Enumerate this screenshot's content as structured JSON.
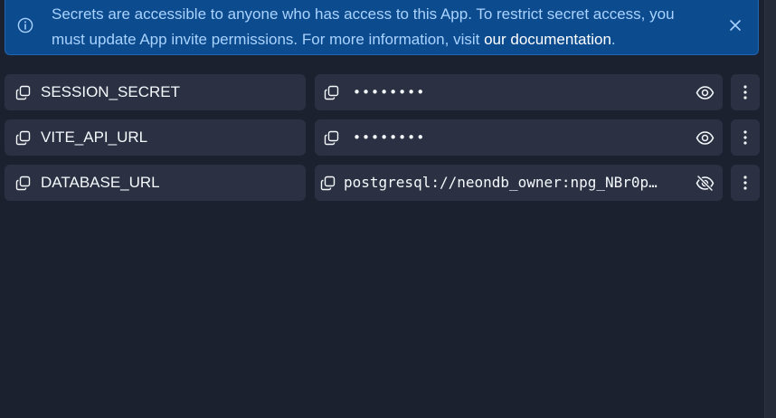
{
  "banner": {
    "message": "Secrets are accessible to anyone who has access to this App. To restrict secret access, you must update App invite permissions. For more information, visit ",
    "link_text": "our documentation",
    "trailing": "."
  },
  "secrets": [
    {
      "key": "SESSION_SECRET",
      "value": "••••••••",
      "revealed": false
    },
    {
      "key": "VITE_API_URL",
      "value": "••••••••",
      "revealed": false
    },
    {
      "key": "DATABASE_URL",
      "value": "postgresql://neondb_owner:npg_NBr0p…",
      "revealed": true
    }
  ],
  "colors": {
    "background": "#1c2130",
    "row_background": "#2b3043",
    "banner_background": "#0d4b8f",
    "banner_text": "#a9d3ff"
  },
  "icons": {
    "banner": "info-icon",
    "dismiss": "close-icon",
    "copy": "copy-icon",
    "reveal": "eye-icon",
    "hide": "eye-off-icon",
    "menu": "more-vertical-icon"
  }
}
